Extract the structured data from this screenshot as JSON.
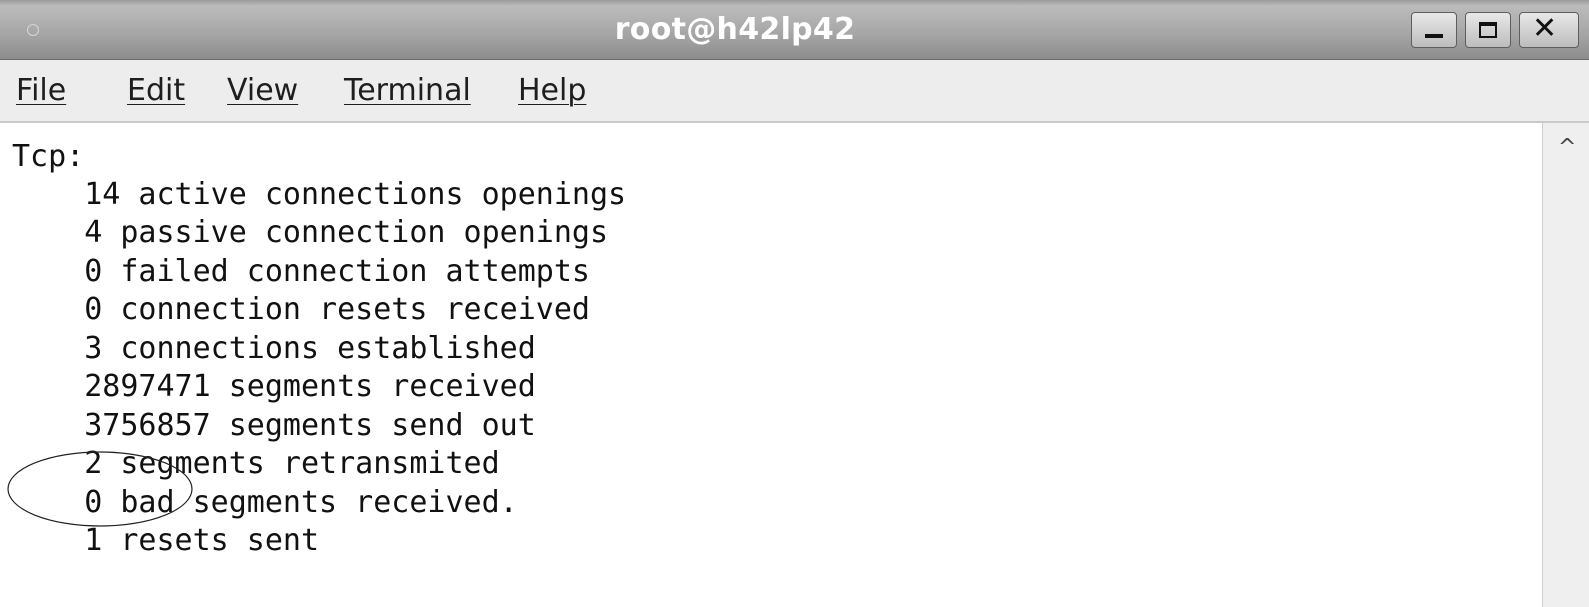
{
  "window": {
    "title": "root@h42lp42",
    "close_glyph": "✕"
  },
  "menu": {
    "items": [
      {
        "label": "File"
      },
      {
        "label": "Edit"
      },
      {
        "label": "View"
      },
      {
        "label": "Terminal"
      },
      {
        "label": "Help"
      }
    ]
  },
  "terminal": {
    "lines": [
      "Tcp:",
      "    14 active connections openings",
      "    4 passive connection openings",
      "    0 failed connection attempts",
      "    0 connection resets received",
      "    3 connections established",
      "    2897471 segments received",
      "    3756857 segments send out",
      "    2 segments retransmited",
      "    0 bad segments received.",
      "    1 resets sent"
    ]
  },
  "scrollbar": {
    "up_arrow_glyph": "^"
  },
  "icons": {
    "window_menu": "circle-icon",
    "minimize": "minimize-icon",
    "maximize": "maximize-icon",
    "close": "close-icon",
    "scroll_up": "chevron-up-icon",
    "annotation": "ellipse-annotation"
  }
}
